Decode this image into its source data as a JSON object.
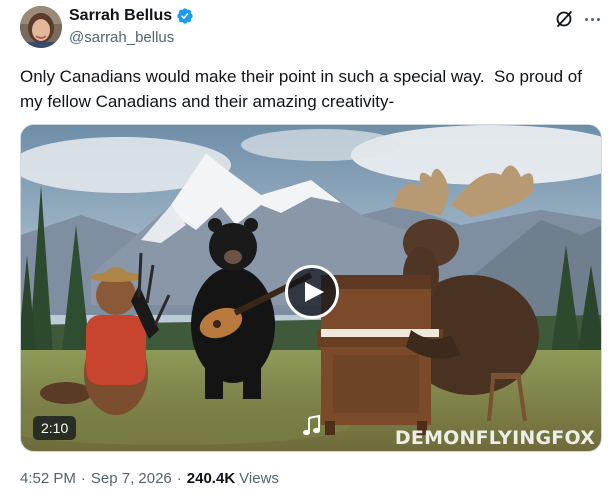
{
  "author": {
    "display_name": "Sarrah Bellus",
    "handle": "@sarrah_bellus",
    "verified": true,
    "avatar_icon": "avatar-photo"
  },
  "header_actions": {
    "grok_icon": "grok-icon",
    "more_icon": "more-icon"
  },
  "tweet": {
    "text": "Only Canadians would make their point in such a special way.  So proud of my fellow Canadians and their amazing creativity-"
  },
  "media": {
    "type": "video",
    "duration": "2:10",
    "watermark": "DEMONFLYINGFOX",
    "play_icon": "play-icon",
    "sound_icon": "music-note-icon"
  },
  "meta": {
    "time": "4:52 PM",
    "separator": "·",
    "date": "Sep 7, 2026",
    "views_count": "240.4K",
    "views_label": "Views"
  },
  "colors": {
    "text_primary": "#0f1419",
    "text_secondary": "#536471",
    "verified_blue": "#1d9bf0",
    "border": "#cfd9de"
  }
}
